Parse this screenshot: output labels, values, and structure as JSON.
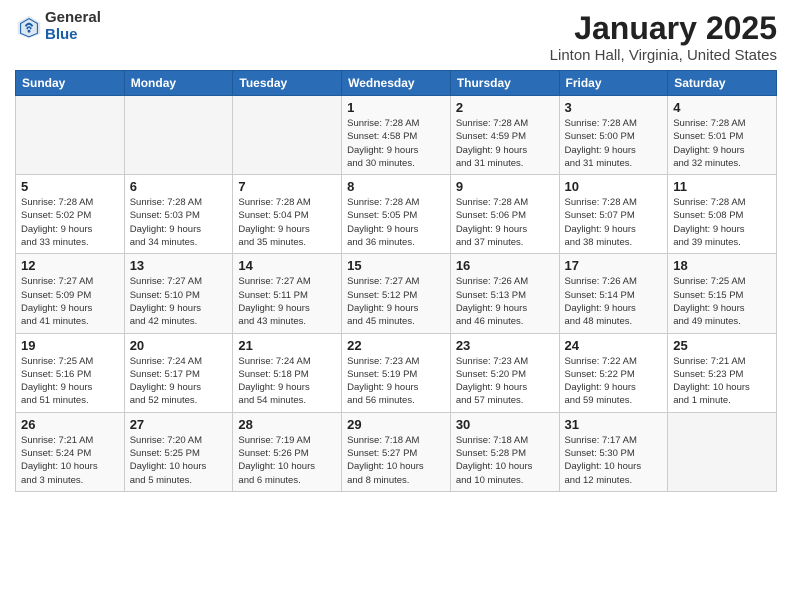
{
  "header": {
    "logo_general": "General",
    "logo_blue": "Blue",
    "title": "January 2025",
    "subtitle": "Linton Hall, Virginia, United States"
  },
  "weekdays": [
    "Sunday",
    "Monday",
    "Tuesday",
    "Wednesday",
    "Thursday",
    "Friday",
    "Saturday"
  ],
  "weeks": [
    [
      {
        "day": "",
        "info": ""
      },
      {
        "day": "",
        "info": ""
      },
      {
        "day": "",
        "info": ""
      },
      {
        "day": "1",
        "info": "Sunrise: 7:28 AM\nSunset: 4:58 PM\nDaylight: 9 hours\nand 30 minutes."
      },
      {
        "day": "2",
        "info": "Sunrise: 7:28 AM\nSunset: 4:59 PM\nDaylight: 9 hours\nand 31 minutes."
      },
      {
        "day": "3",
        "info": "Sunrise: 7:28 AM\nSunset: 5:00 PM\nDaylight: 9 hours\nand 31 minutes."
      },
      {
        "day": "4",
        "info": "Sunrise: 7:28 AM\nSunset: 5:01 PM\nDaylight: 9 hours\nand 32 minutes."
      }
    ],
    [
      {
        "day": "5",
        "info": "Sunrise: 7:28 AM\nSunset: 5:02 PM\nDaylight: 9 hours\nand 33 minutes."
      },
      {
        "day": "6",
        "info": "Sunrise: 7:28 AM\nSunset: 5:03 PM\nDaylight: 9 hours\nand 34 minutes."
      },
      {
        "day": "7",
        "info": "Sunrise: 7:28 AM\nSunset: 5:04 PM\nDaylight: 9 hours\nand 35 minutes."
      },
      {
        "day": "8",
        "info": "Sunrise: 7:28 AM\nSunset: 5:05 PM\nDaylight: 9 hours\nand 36 minutes."
      },
      {
        "day": "9",
        "info": "Sunrise: 7:28 AM\nSunset: 5:06 PM\nDaylight: 9 hours\nand 37 minutes."
      },
      {
        "day": "10",
        "info": "Sunrise: 7:28 AM\nSunset: 5:07 PM\nDaylight: 9 hours\nand 38 minutes."
      },
      {
        "day": "11",
        "info": "Sunrise: 7:28 AM\nSunset: 5:08 PM\nDaylight: 9 hours\nand 39 minutes."
      }
    ],
    [
      {
        "day": "12",
        "info": "Sunrise: 7:27 AM\nSunset: 5:09 PM\nDaylight: 9 hours\nand 41 minutes."
      },
      {
        "day": "13",
        "info": "Sunrise: 7:27 AM\nSunset: 5:10 PM\nDaylight: 9 hours\nand 42 minutes."
      },
      {
        "day": "14",
        "info": "Sunrise: 7:27 AM\nSunset: 5:11 PM\nDaylight: 9 hours\nand 43 minutes."
      },
      {
        "day": "15",
        "info": "Sunrise: 7:27 AM\nSunset: 5:12 PM\nDaylight: 9 hours\nand 45 minutes."
      },
      {
        "day": "16",
        "info": "Sunrise: 7:26 AM\nSunset: 5:13 PM\nDaylight: 9 hours\nand 46 minutes."
      },
      {
        "day": "17",
        "info": "Sunrise: 7:26 AM\nSunset: 5:14 PM\nDaylight: 9 hours\nand 48 minutes."
      },
      {
        "day": "18",
        "info": "Sunrise: 7:25 AM\nSunset: 5:15 PM\nDaylight: 9 hours\nand 49 minutes."
      }
    ],
    [
      {
        "day": "19",
        "info": "Sunrise: 7:25 AM\nSunset: 5:16 PM\nDaylight: 9 hours\nand 51 minutes."
      },
      {
        "day": "20",
        "info": "Sunrise: 7:24 AM\nSunset: 5:17 PM\nDaylight: 9 hours\nand 52 minutes."
      },
      {
        "day": "21",
        "info": "Sunrise: 7:24 AM\nSunset: 5:18 PM\nDaylight: 9 hours\nand 54 minutes."
      },
      {
        "day": "22",
        "info": "Sunrise: 7:23 AM\nSunset: 5:19 PM\nDaylight: 9 hours\nand 56 minutes."
      },
      {
        "day": "23",
        "info": "Sunrise: 7:23 AM\nSunset: 5:20 PM\nDaylight: 9 hours\nand 57 minutes."
      },
      {
        "day": "24",
        "info": "Sunrise: 7:22 AM\nSunset: 5:22 PM\nDaylight: 9 hours\nand 59 minutes."
      },
      {
        "day": "25",
        "info": "Sunrise: 7:21 AM\nSunset: 5:23 PM\nDaylight: 10 hours\nand 1 minute."
      }
    ],
    [
      {
        "day": "26",
        "info": "Sunrise: 7:21 AM\nSunset: 5:24 PM\nDaylight: 10 hours\nand 3 minutes."
      },
      {
        "day": "27",
        "info": "Sunrise: 7:20 AM\nSunset: 5:25 PM\nDaylight: 10 hours\nand 5 minutes."
      },
      {
        "day": "28",
        "info": "Sunrise: 7:19 AM\nSunset: 5:26 PM\nDaylight: 10 hours\nand 6 minutes."
      },
      {
        "day": "29",
        "info": "Sunrise: 7:18 AM\nSunset: 5:27 PM\nDaylight: 10 hours\nand 8 minutes."
      },
      {
        "day": "30",
        "info": "Sunrise: 7:18 AM\nSunset: 5:28 PM\nDaylight: 10 hours\nand 10 minutes."
      },
      {
        "day": "31",
        "info": "Sunrise: 7:17 AM\nSunset: 5:30 PM\nDaylight: 10 hours\nand 12 minutes."
      },
      {
        "day": "",
        "info": ""
      }
    ]
  ]
}
